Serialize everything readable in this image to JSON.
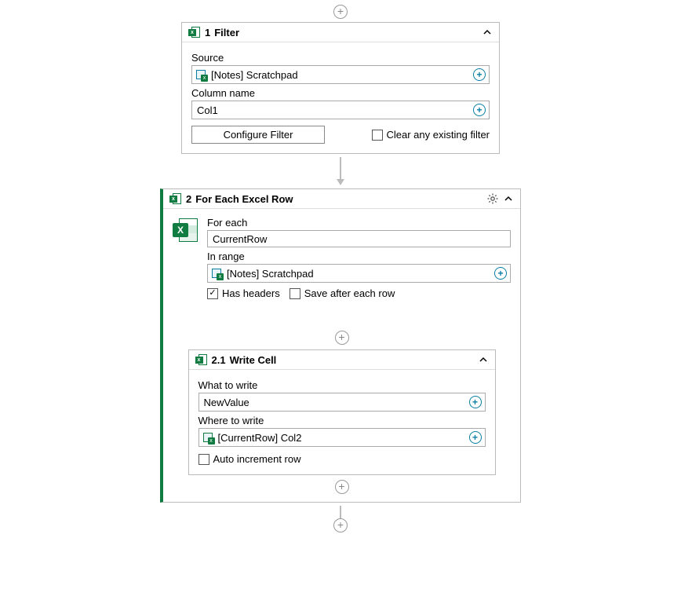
{
  "activity1": {
    "index": "1",
    "title": "Filter",
    "source_label": "Source",
    "source_value": "[Notes] Scratchpad",
    "column_label": "Column name",
    "column_value": "Col1",
    "configure_btn": "Configure Filter",
    "clear_cb": "Clear any existing filter",
    "clear_checked": false
  },
  "activity2": {
    "index": "2",
    "title": "For Each Excel Row",
    "foreach_label": "For each",
    "foreach_value": "CurrentRow",
    "inrange_label": "In range",
    "inrange_value": "[Notes] Scratchpad",
    "has_headers_label": "Has headers",
    "has_headers_checked": true,
    "save_label": "Save after each row",
    "save_checked": false
  },
  "activity21": {
    "index": "2.1",
    "title": "Write Cell",
    "what_label": "What to write",
    "what_value": "NewValue",
    "where_label": "Where to write",
    "where_value": "[CurrentRow] Col2",
    "auto_label": "Auto increment row",
    "auto_checked": false
  }
}
